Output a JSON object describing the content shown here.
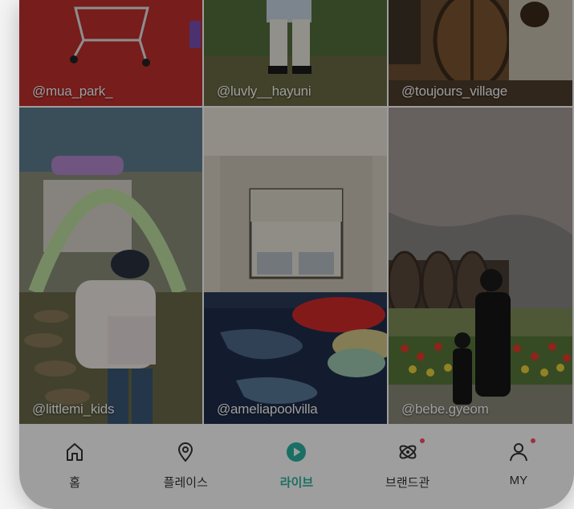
{
  "grid": {
    "tiles": [
      {
        "handle": "@mua_park_"
      },
      {
        "handle": "@luvly__hayuni"
      },
      {
        "handle": "@toujours_village"
      },
      {
        "handle": "@littlemi_kids"
      },
      {
        "handle": "@ameliapoolvilla"
      },
      {
        "handle": "@bebe.gyeom"
      }
    ]
  },
  "tabbar": {
    "items": [
      {
        "label": "홈",
        "icon": "home-icon"
      },
      {
        "label": "플레이스",
        "icon": "map-pin-icon"
      },
      {
        "label": "라이브",
        "icon": "play-icon"
      },
      {
        "label": "브랜드관",
        "icon": "atom-icon"
      },
      {
        "label": "MY",
        "icon": "user-icon"
      }
    ],
    "active_color": "#2bb3a0",
    "badge_color": "#ff4d6d"
  }
}
